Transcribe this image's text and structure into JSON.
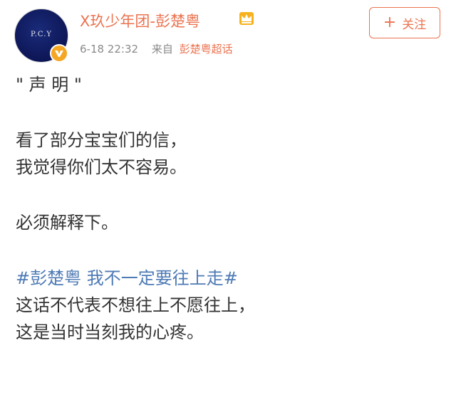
{
  "post": {
    "author": {
      "name": "X玖少年团-彭楚粤",
      "avatar_text": "P.C.Y",
      "verified": true,
      "icons": [
        "crown-icon",
        "verified-icon"
      ]
    },
    "time": "6-18 22:32",
    "from_label": "来自",
    "source": "彭楚粤超话",
    "follow_button": {
      "plus": "+",
      "label": "关注"
    },
    "paragraphs": [
      {
        "lines": [
          "\" 声 明 \""
        ]
      },
      {
        "lines": [
          "看了部分宝宝们的信，",
          "我觉得你们太不容易。"
        ]
      },
      {
        "lines": [
          "必须解释下。"
        ]
      },
      {
        "hashtag": "#彭楚粤 我不一定要往上走#",
        "lines": [
          "这话不代表不想往上不愿往上，",
          "这是当时当刻我的心疼。"
        ]
      }
    ]
  },
  "colors": {
    "accent": "#eb7350",
    "hashtag": "#4e7ab5",
    "text": "#333333",
    "meta": "#8a8a8a"
  }
}
